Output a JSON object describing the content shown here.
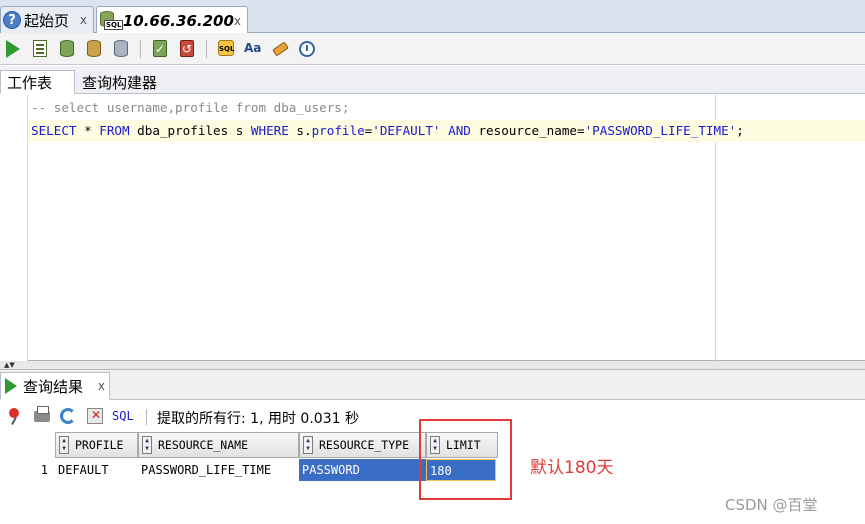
{
  "doc_tabs": [
    {
      "label": "起始页",
      "close": "x"
    },
    {
      "label": "10.66.36.200",
      "close": "x"
    }
  ],
  "worksheet_tabs": {
    "worksheet": "工作表",
    "query_builder": "查询构建器"
  },
  "editor": {
    "line1": "-- select username,profile from dba_users;",
    "line2": {
      "kw_select": "SELECT",
      "t1": " * ",
      "kw_from": "FROM",
      "t2": " dba_profiles s ",
      "kw_where": "WHERE",
      "t3": " s.",
      "kw_profile": "profile",
      "t4": "=",
      "str_default": "'DEFAULT'",
      "t5": " ",
      "kw_and": "AND",
      "t6": " resource_name=",
      "str_plt": "'PASSWORD_LIFE_TIME'",
      "t7": ";"
    }
  },
  "results": {
    "tab_label": "查询结果",
    "tab_close": "x",
    "sql_link": "SQL",
    "status": "提取的所有行: 1, 用时 0.031 秒",
    "columns": [
      "PROFILE",
      "RESOURCE_NAME",
      "RESOURCE_TYPE",
      "LIMIT"
    ],
    "rows": [
      {
        "num": "1",
        "cells": [
          "DEFAULT",
          "PASSWORD_LIFE_TIME",
          "PASSWORD",
          "180"
        ]
      }
    ]
  },
  "annotation": "默认180天",
  "watermark": "CSDN @百堂",
  "colors": {
    "keyword": "#1a1acd",
    "selection": "#3a6ec6",
    "annotation": "#e53a3a"
  }
}
